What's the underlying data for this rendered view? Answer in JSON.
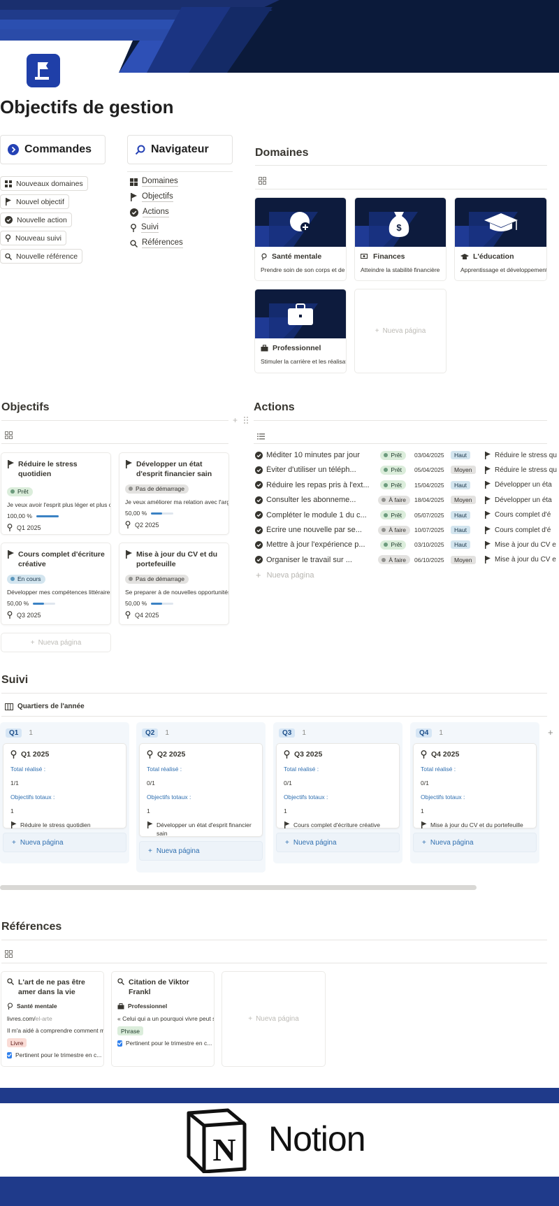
{
  "page": {
    "title": "Objectifs de gestion"
  },
  "commands": {
    "title": "Commandes",
    "buttons": [
      "Nouveaux domaines",
      "Nouvel objectif",
      "Nouvelle action",
      "Nouveau suivi",
      "Nouvelle référence"
    ]
  },
  "navigator": {
    "title": "Navigateur",
    "links": [
      "Domaines",
      "Objectifs",
      "Actions",
      "Suivi",
      "Références"
    ]
  },
  "domains": {
    "title": "Domaines",
    "cards": [
      {
        "title": "Santé mentale",
        "desc": "Prendre soin de son corps et de sc",
        "icon": "brain-icon"
      },
      {
        "title": "Finances",
        "desc": "Atteindre la stabilité financière",
        "icon": "money-icon"
      },
      {
        "title": "L'éducation",
        "desc": "Apprentissage et développement i",
        "icon": "graduation-cap-icon"
      },
      {
        "title": "Professionnel",
        "desc": "Stimuler la carrière et les réalisatio",
        "icon": "briefcase-icon"
      }
    ],
    "new_page": "Nueva página"
  },
  "objectives": {
    "title": "Objectifs",
    "cards": [
      {
        "title": "Réduire le stress quotidien",
        "status": "Prêt",
        "desc": "Je veux avoir l'esprit plus léger et plus con",
        "progress_label": "100,00 %",
        "progress": 1.0,
        "quarter": "Q1 2025"
      },
      {
        "title": "Développer un état d'esprit financier sain",
        "status": "Pas de démarrage",
        "desc": "Je veux améliorer ma relation avec l'argen",
        "progress_label": "50,00 %",
        "progress": 0.5,
        "quarter": "Q2 2025"
      },
      {
        "title": "Cours complet d'écriture créative",
        "status": "En cours",
        "desc": "Développer mes compétences littéraires",
        "progress_label": "50,00 %",
        "progress": 0.5,
        "quarter": "Q3 2025"
      },
      {
        "title": "Mise à jour du CV et du portefeuille",
        "status": "Pas de démarrage",
        "desc": "Se preparer à de nouvelles opportunités d",
        "progress_label": "50,00 %",
        "progress": 0.5,
        "quarter": "Q4 2025"
      }
    ],
    "new_page": "Nueva página"
  },
  "actions": {
    "title": "Actions",
    "rows": [
      {
        "name": "Méditer 10 minutes par jour",
        "status": "Prêt",
        "date": "03/04/2025",
        "priority": "Haut",
        "rel": "Réduire le stress qu"
      },
      {
        "name": "Éviter d'utiliser un téléph...",
        "status": "Prêt",
        "date": "05/04/2025",
        "priority": "Moyen",
        "rel": "Réduire le stress qu"
      },
      {
        "name": "Réduire les repas pris à l'ext...",
        "status": "Prêt",
        "date": "15/04/2025",
        "priority": "Haut",
        "rel": "Développer un éta"
      },
      {
        "name": "Consulter les abonneme...",
        "status": "À faire",
        "date": "18/04/2025",
        "priority": "Moyen",
        "rel": "Développer un éta"
      },
      {
        "name": "Compléter le module 1 du c...",
        "status": "Prêt",
        "date": "05/07/2025",
        "priority": "Haut",
        "rel": "Cours complet d'é"
      },
      {
        "name": "Écrire une nouvelle par se...",
        "status": "À faire",
        "date": "10/07/2025",
        "priority": "Haut",
        "rel": "Cours complet d'é"
      },
      {
        "name": "Mettre à jour l'expérience p...",
        "status": "Prêt",
        "date": "03/10/2025",
        "priority": "Haut",
        "rel": "Mise à jour du CV e"
      },
      {
        "name": "Organiser le travail sur ...",
        "status": "À faire",
        "date": "06/10/2025",
        "priority": "Moyen",
        "rel": "Mise à jour du CV e"
      }
    ],
    "new_page": "Nueva página"
  },
  "tracking": {
    "title": "Suivi",
    "view": "Quartiers de l'année",
    "total_label": "Total réalisé :",
    "objectives_label": "Objectifs totaux :",
    "new_page": "Nueva página",
    "columns": [
      {
        "tag": "Q1",
        "count": "1",
        "card": "Q1 2025",
        "total": "1/1",
        "objectives": "1",
        "rel": "Réduire le stress quotidien"
      },
      {
        "tag": "Q2",
        "count": "1",
        "card": "Q2 2025",
        "total": "0/1",
        "objectives": "1",
        "rel": "Développer un état d'esprit financier sain"
      },
      {
        "tag": "Q3",
        "count": "1",
        "card": "Q3 2025",
        "total": "0/1",
        "objectives": "1",
        "rel": "Cours complet d'écriture créative"
      },
      {
        "tag": "Q4",
        "count": "1",
        "card": "Q4 2025",
        "total": "0/1",
        "objectives": "1",
        "rel": "Mise à jour du CV et du portefeuille"
      }
    ]
  },
  "references": {
    "title": "Références",
    "cards": [
      {
        "title": "L'art de ne pas être amer dans la vie",
        "domain": "Santé mentale",
        "link": "livres.com/",
        "link_tail": "el-arte",
        "desc": "Il m'a aidé à comprendre comment mo",
        "type": "Livre",
        "check": "Pertinent pour le trimestre en c..."
      },
      {
        "title": "Citation de Viktor Frankl",
        "domain": "Professionnel",
        "desc": "« Celui qui a un pourquoi vivre peut sup",
        "type": "Phrase",
        "check": "Pertinent pour le trimestre en c..."
      }
    ],
    "new_page": "Nueva página"
  },
  "footer": {
    "brand": "Notion"
  },
  "colors": {
    "navy": "#0d1b3d",
    "brand_blue": "#1f3fa8",
    "ready_green": "#dbeddb",
    "todo_gray": "#e3e2e0",
    "inprogress_blue": "#d3e5ef"
  }
}
